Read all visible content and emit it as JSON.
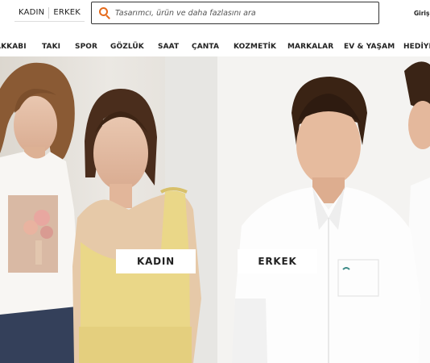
{
  "header": {
    "gender_tabs": [
      "KADIN",
      "ERKEK"
    ],
    "search_placeholder": "Tasarımcı, ürün ve daha fazlasını ara",
    "login_label": "Giriş",
    "accent_color": "#e56a1b"
  },
  "nav": {
    "items": [
      "AKKABI",
      "TAKI",
      "SPOR",
      "GÖZLÜK",
      "SAAT",
      "ÇANTA",
      "KOZMETİK",
      "MARKALAR",
      "EV & YAŞAM",
      "HEDİYE"
    ]
  },
  "hero": {
    "left_cta": "KADIN",
    "right_cta": "ERKEK"
  }
}
